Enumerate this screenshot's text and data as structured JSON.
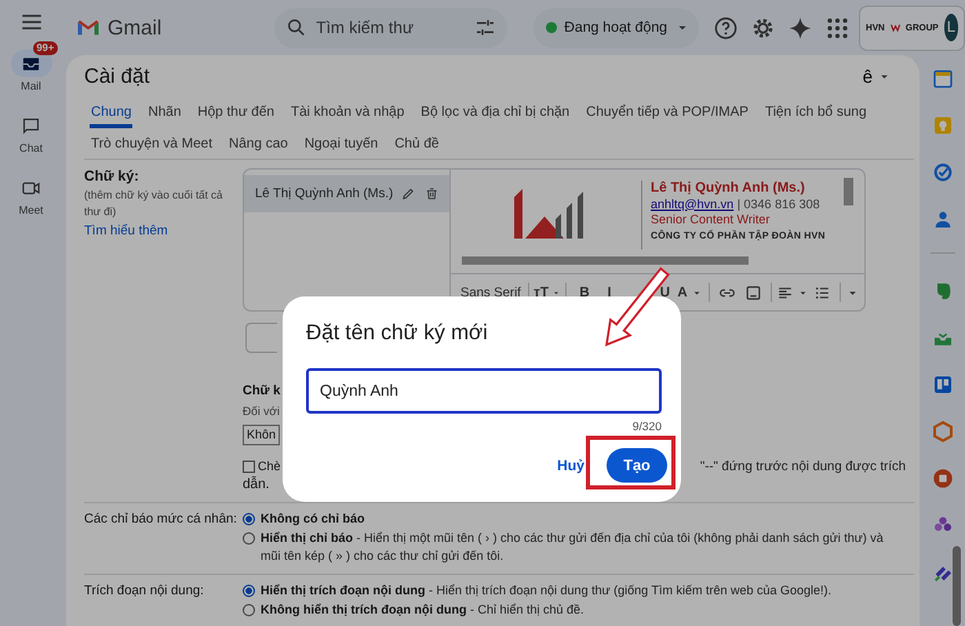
{
  "rail": {
    "items": [
      {
        "label": "Mail",
        "badge": "99+",
        "selected": true
      },
      {
        "label": "Chat",
        "selected": false
      },
      {
        "label": "Meet",
        "selected": false
      }
    ]
  },
  "header": {
    "product": "Gmail",
    "search": {
      "placeholder": "Tìm kiếm thư"
    },
    "status": {
      "label": "Đang hoạt động",
      "color": "#1b7a35"
    },
    "account": {
      "logo_left": "HVN",
      "logo_right": "GROUP",
      "avatar": "L"
    }
  },
  "settings": {
    "title": "Cài đặt",
    "input_tool": "ê",
    "tab_rows": [
      [
        {
          "label": "Chung",
          "selected": true
        },
        {
          "label": "Nhãn",
          "selected": false
        },
        {
          "label": "Hộp thư đến",
          "selected": false
        },
        {
          "label": "Tài khoản và nhập",
          "selected": false
        },
        {
          "label": "Bộ lọc và địa chỉ bị chặn",
          "selected": false
        },
        {
          "label": "Chuyển tiếp và POP/IMAP",
          "selected": false
        },
        {
          "label": "Tiện ích bổ sung",
          "selected": false
        }
      ],
      [
        {
          "label": "Trò chuyện và Meet",
          "selected": false
        },
        {
          "label": "Nâng cao",
          "selected": false
        },
        {
          "label": "Ngoại tuyến",
          "selected": false
        },
        {
          "label": "Chủ đề",
          "selected": false
        }
      ]
    ],
    "signature": {
      "label": "Chữ ký:",
      "hint": "(thêm chữ ký vào cuối tất cả thư đi)",
      "link": "Tìm hiểu thêm",
      "entries": [
        {
          "name": "Lê Thị Quỳnh Anh (Ms.)",
          "selected": true
        }
      ],
      "preview": {
        "name": "Lê Thị Quỳnh Anh (Ms.)",
        "email": "anhltq@hvn.vn",
        "phone": "| 0346 816 308",
        "role": "Senior Content Writer",
        "company": "CÔNG TY CỔ PHẦN TẬP ĐOÀN HVN"
      },
      "toolbar": {
        "font": "Sans Serif",
        "size": "тT",
        "bold": "B",
        "italic": "I",
        "underline": "U",
        "text_color": "A"
      }
    },
    "defaults": {
      "label": "Chữ k",
      "note": "Đối với",
      "select": "Khôn"
    },
    "insert_option": {
      "checked": false,
      "label": "Chè",
      "continuation": "\"--\" đứng trước nội dung được trích",
      "tail": "dẫn."
    },
    "indicators": {
      "label": "Các chỉ báo mức cá nhân:",
      "options": [
        {
          "title": "Không có chỉ báo",
          "selected": true
        },
        {
          "title": "Hiển thị chỉ báo",
          "description": "- Hiển thị một mũi tên ( › ) cho các thư gửi đến địa chỉ của tôi (không phải danh sách gửi thư) và mũi tên kép ( » ) cho các thư chỉ gửi đến tôi.",
          "selected": false
        }
      ]
    },
    "snippets": {
      "label": "Trích đoạn nội dung:",
      "options": [
        {
          "title": "Hiển thị trích đoạn nội dung",
          "description": "- Hiển thị trích đoạn nội dung thư (giống Tìm kiếm trên web của Google!).",
          "selected": true
        },
        {
          "title": "Không hiển thị trích đoạn nội dung",
          "description": "- Chỉ hiển thị chủ đề.",
          "selected": false
        }
      ]
    }
  },
  "dialog": {
    "title": "Đặt tên chữ ký mới",
    "field": {
      "value": "Quỳnh Anh",
      "focused": true
    },
    "counter": "9/320",
    "buttons": [
      {
        "label": "Huỷ",
        "kind": "text"
      },
      {
        "label": "Tạo",
        "kind": "filled"
      }
    ]
  }
}
